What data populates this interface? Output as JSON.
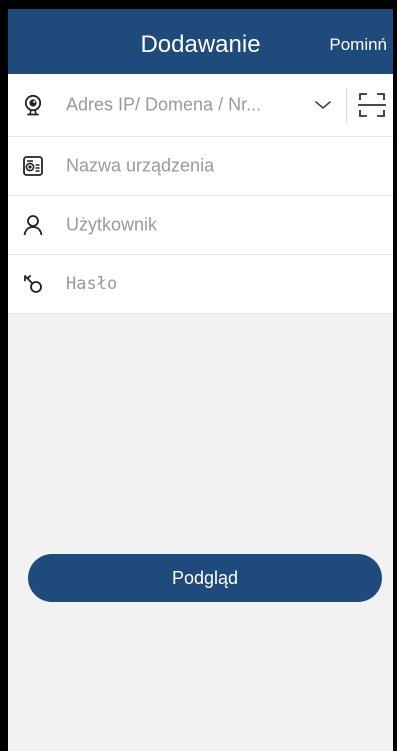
{
  "header": {
    "title": "Dodawanie",
    "skip_label": "Pominń"
  },
  "form": {
    "address": {
      "placeholder": "Adres IP/ Domena / Nr...",
      "icon": "webcam-icon",
      "dropdown_icon": "chevron-down-icon",
      "scan_icon": "qr-scan-icon"
    },
    "device_name": {
      "placeholder": "Nazwa urządzenia",
      "icon": "device-card-icon"
    },
    "username": {
      "placeholder": "Użytkownik",
      "icon": "user-icon"
    },
    "password": {
      "placeholder": "Hasło",
      "icon": "key-icon"
    }
  },
  "actions": {
    "preview_label": "Podgląd"
  },
  "colors": {
    "primary": "#1f4a7c",
    "background": "#f2f2f2",
    "field_background": "#ffffff"
  }
}
